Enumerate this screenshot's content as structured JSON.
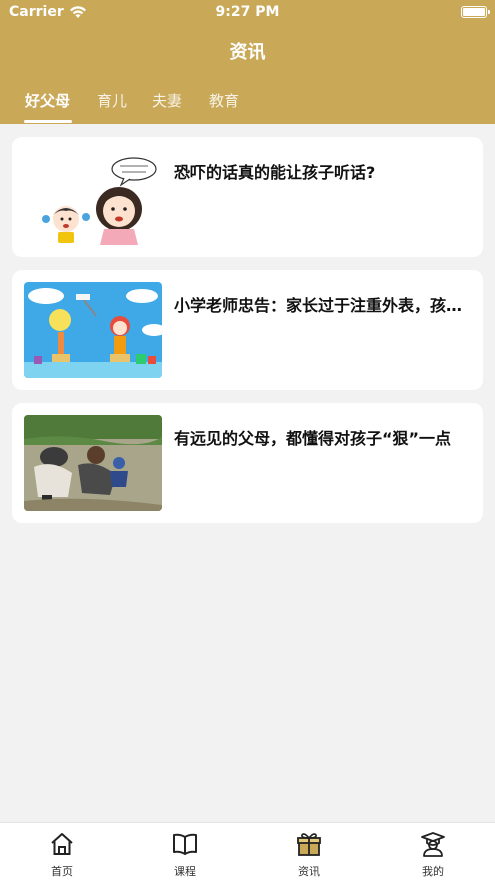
{
  "status_bar": {
    "carrier": "Carrier",
    "time": "9:27 PM"
  },
  "header": {
    "title": "资讯"
  },
  "tabs": [
    {
      "label": "好父母",
      "active": true
    },
    {
      "label": "育儿",
      "active": false
    },
    {
      "label": "夫妻",
      "active": false
    },
    {
      "label": "教育",
      "active": false
    }
  ],
  "articles": [
    {
      "title": "恐吓的话真的能让孩子听话?"
    },
    {
      "title": "小学老师忠告：家长过于注重外表，孩子会输在起跑线上"
    },
    {
      "title": "有远见的父母，都懂得对孩子“狠”一点"
    }
  ],
  "bottom_nav": [
    {
      "label": "首页",
      "icon": "home-icon"
    },
    {
      "label": "课程",
      "icon": "book-icon"
    },
    {
      "label": "资讯",
      "icon": "gift-icon",
      "active": true
    },
    {
      "label": "我的",
      "icon": "graduate-icon"
    }
  ],
  "colors": {
    "header": "#c9a858",
    "background": "#f2f2f2",
    "accent": "#c9a858"
  }
}
